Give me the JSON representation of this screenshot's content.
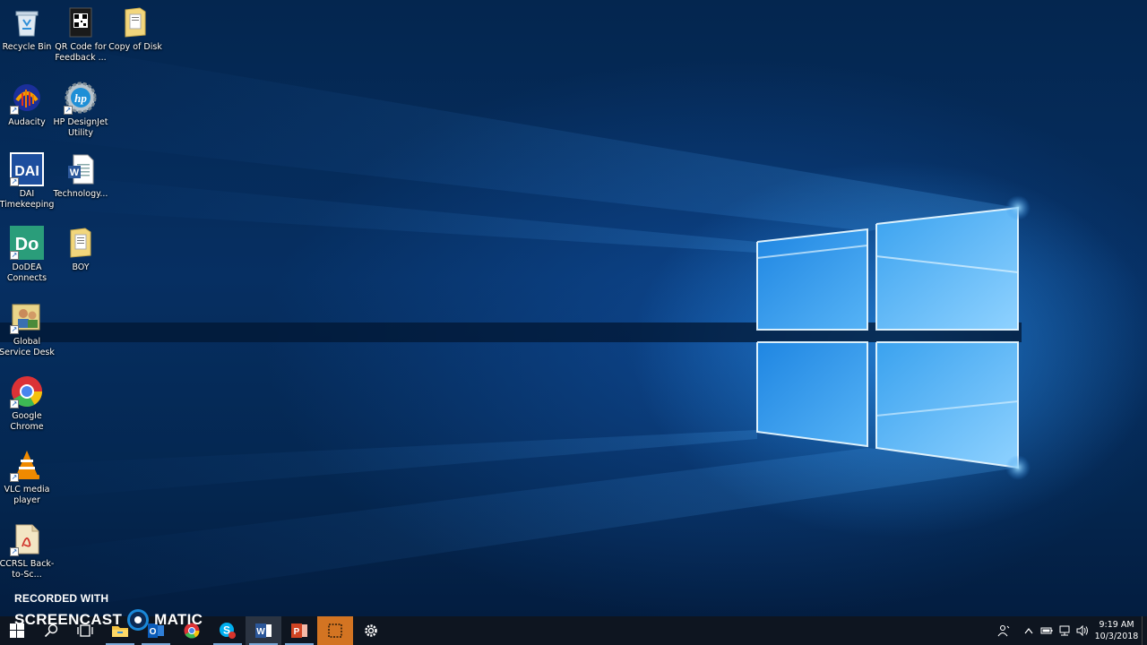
{
  "desktop": {
    "icons": [
      {
        "label": "Recycle Bin",
        "icon": "recycle-bin-icon"
      },
      {
        "label": "QR Code for Feedback ...",
        "icon": "qr-code-file-icon"
      },
      {
        "label": "Copy of Disk",
        "icon": "folder-icon"
      },
      {
        "label": "Audacity",
        "icon": "audacity-icon"
      },
      {
        "label": "HP DesignJet Utility",
        "icon": "hp-designjet-icon"
      },
      {
        "label": "DAI Timekeeping",
        "icon": "dai-timekeeping-icon"
      },
      {
        "label": "Technology...",
        "icon": "word-document-icon"
      },
      {
        "label": "DoDEA Connects",
        "icon": "dodea-connects-icon"
      },
      {
        "label": "BOY",
        "icon": "folder-icon"
      },
      {
        "label": "Global Service Desk",
        "icon": "global-service-desk-icon"
      },
      {
        "label": "Google Chrome",
        "icon": "chrome-icon"
      },
      {
        "label": "VLC media player",
        "icon": "vlc-icon"
      },
      {
        "label": "CCRSL Back-to-Sc...",
        "icon": "pdf-document-icon"
      }
    ]
  },
  "watermark": {
    "line1": "RECORDED WITH",
    "left": "SCREENCAST",
    "right": "MATIC"
  },
  "taskbar": {
    "buttons": [
      {
        "name": "start",
        "icon": "windows-start-icon"
      },
      {
        "name": "search",
        "icon": "search-icon"
      },
      {
        "name": "task-view",
        "icon": "task-view-icon"
      },
      {
        "name": "file-explorer",
        "icon": "file-explorer-icon",
        "running": true
      },
      {
        "name": "outlook",
        "icon": "outlook-icon",
        "running": true
      },
      {
        "name": "chrome",
        "icon": "chrome-icon"
      },
      {
        "name": "skype",
        "icon": "skype-icon",
        "running": true
      },
      {
        "name": "word",
        "icon": "word-icon",
        "running": true,
        "active": true
      },
      {
        "name": "powerpoint",
        "icon": "powerpoint-icon",
        "running": true
      },
      {
        "name": "snipping-tool",
        "icon": "snipping-tool-icon",
        "highlight": true
      },
      {
        "name": "settings",
        "icon": "gear-icon"
      }
    ],
    "tray": {
      "time": "9:19 AM",
      "date": "10/3/2018"
    }
  },
  "colors": {
    "taskbar_bg": "#0e1520",
    "accent_running": "#7aa9d8",
    "highlight_orange": "#d37422",
    "wallpaper_light": "#6fc4ff"
  }
}
